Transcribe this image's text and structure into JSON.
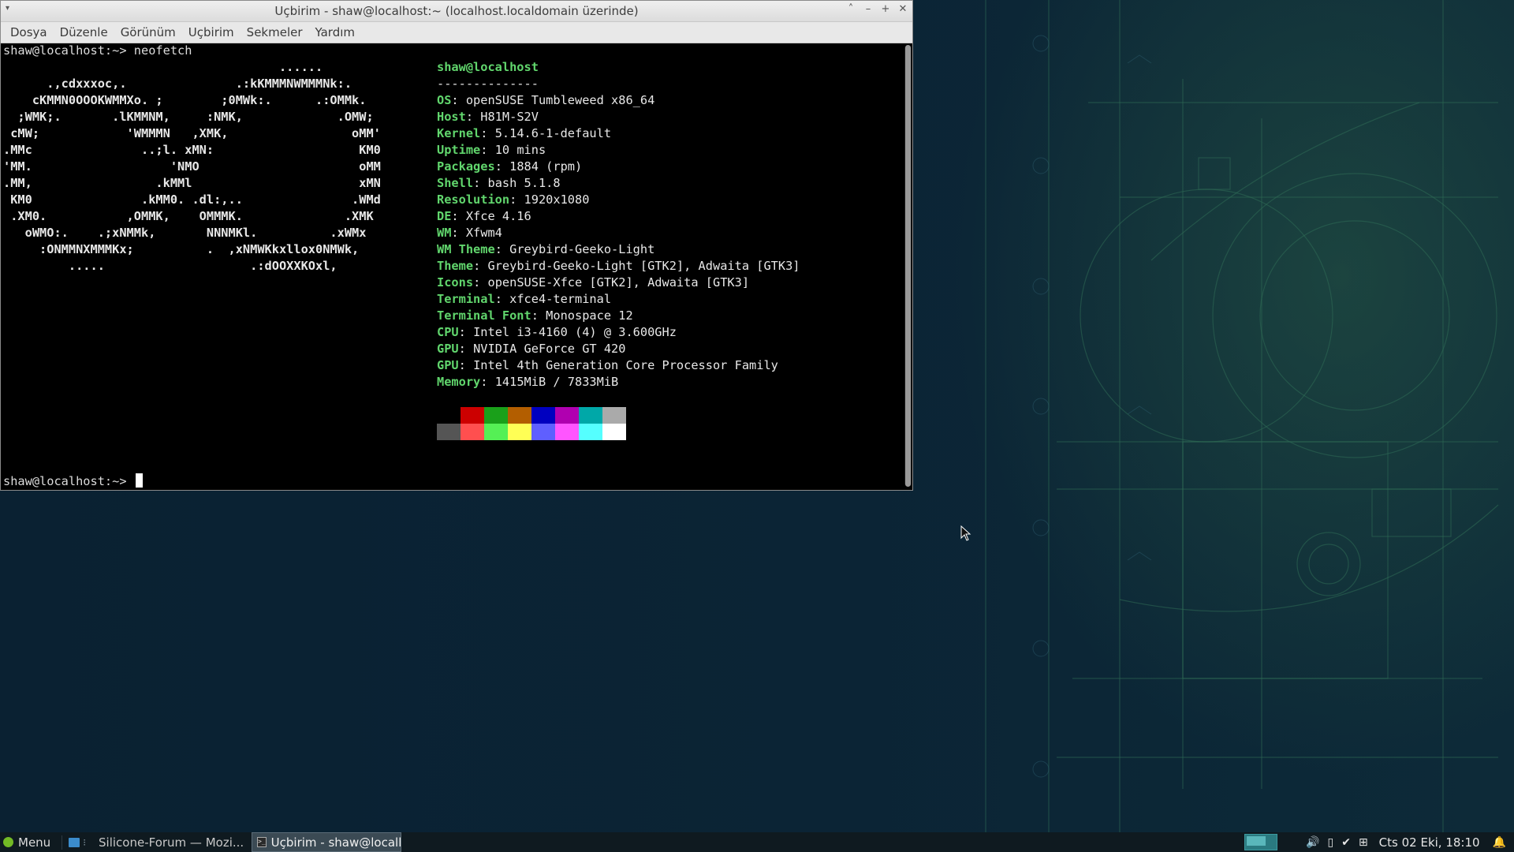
{
  "window": {
    "title": "Uçbirim - shaw@localhost:~ (localhost.localdomain üzerinde)",
    "menu": [
      "Dosya",
      "Düzenle",
      "Görünüm",
      "Uçbirim",
      "Sekmeler",
      "Yardım"
    ]
  },
  "terminal": {
    "command_line": "shaw@localhost:~> neofetch",
    "prompt_line": "shaw@localhost:~> ",
    "ascii_art": "                                      ......\n      .,cdxxxoc,.               .:kKMMMNWMMMNk:.\n    cKMMN0OOOKWMMXo. ;        ;0MWk:.      .:OMMk.\n  ;WMK;.       .lKMMNM,     :NMK,             .OMW;\n cMW;            'WMMMN   ,XMK,                 oMM'\n.MMc               ..;l. xMN:                    KM0\n'MM.                   'NMO                      oMM\n.MM,                 .kMMl                       xMN\n KM0               .kMM0. .dl:,..               .WMd\n .XM0.           ,OMMK,    OMMMK.              .XMK\n   oWMO:.    .;xNMMk,       NNNMKl.          .xWMx\n     :ONMMNXMMMKx;          .  ,xNMWKkxllox0NMWk,\n         .....                    .:dOOXXKOxl,",
    "user_host": "shaw@localhost",
    "separator": "--------------",
    "info": [
      {
        "key": "OS",
        "value": "openSUSE Tumbleweed x86_64"
      },
      {
        "key": "Host",
        "value": "H81M-S2V"
      },
      {
        "key": "Kernel",
        "value": "5.14.6-1-default"
      },
      {
        "key": "Uptime",
        "value": "10 mins"
      },
      {
        "key": "Packages",
        "value": "1884 (rpm)"
      },
      {
        "key": "Shell",
        "value": "bash 5.1.8"
      },
      {
        "key": "Resolution",
        "value": "1920x1080"
      },
      {
        "key": "DE",
        "value": "Xfce 4.16"
      },
      {
        "key": "WM",
        "value": "Xfwm4"
      },
      {
        "key": "WM Theme",
        "value": "Greybird-Geeko-Light"
      },
      {
        "key": "Theme",
        "value": "Greybird-Geeko-Light [GTK2], Adwaita [GTK3]"
      },
      {
        "key": "Icons",
        "value": "openSUSE-Xfce [GTK2], Adwaita [GTK3]"
      },
      {
        "key": "Terminal",
        "value": "xfce4-terminal"
      },
      {
        "key": "Terminal Font",
        "value": "Monospace 12"
      },
      {
        "key": "CPU",
        "value": "Intel i3-4160 (4) @ 3.600GHz"
      },
      {
        "key": "GPU",
        "value": "NVIDIA GeForce GT 420"
      },
      {
        "key": "GPU",
        "value": "Intel 4th Generation Core Processor Family"
      },
      {
        "key": "Memory",
        "value": "1415MiB / 7833MiB"
      }
    ],
    "palette_top": [
      "#000000",
      "#cc0000",
      "#1aa01a",
      "#b35e00",
      "#0000c0",
      "#b000b0",
      "#00a8a8",
      "#aaaaaa"
    ],
    "palette_bottom": [
      "#555555",
      "#ff4f4f",
      "#55f055",
      "#ffff55",
      "#5f5fff",
      "#ff55ff",
      "#55ffff",
      "#ffffff"
    ]
  },
  "taskbar": {
    "menu_label": "Menu",
    "tasks": [
      {
        "label": "Silicone-Forum — Mozi...",
        "icon": "firefox-icon",
        "active": false
      },
      {
        "label": "Uçbirim - shaw@localh...",
        "icon": "terminal-icon",
        "active": true
      }
    ],
    "clock": "Cts 02 Eki, 18:10",
    "tray_icons": [
      "volume-icon",
      "battery-icon",
      "updates-check-icon",
      "network-icon",
      "notification-bell-icon"
    ]
  },
  "colors": {
    "accent_green": "#61d66d",
    "desktop_bg": "#0b2233",
    "taskbar_bg": "#0f1a20"
  }
}
